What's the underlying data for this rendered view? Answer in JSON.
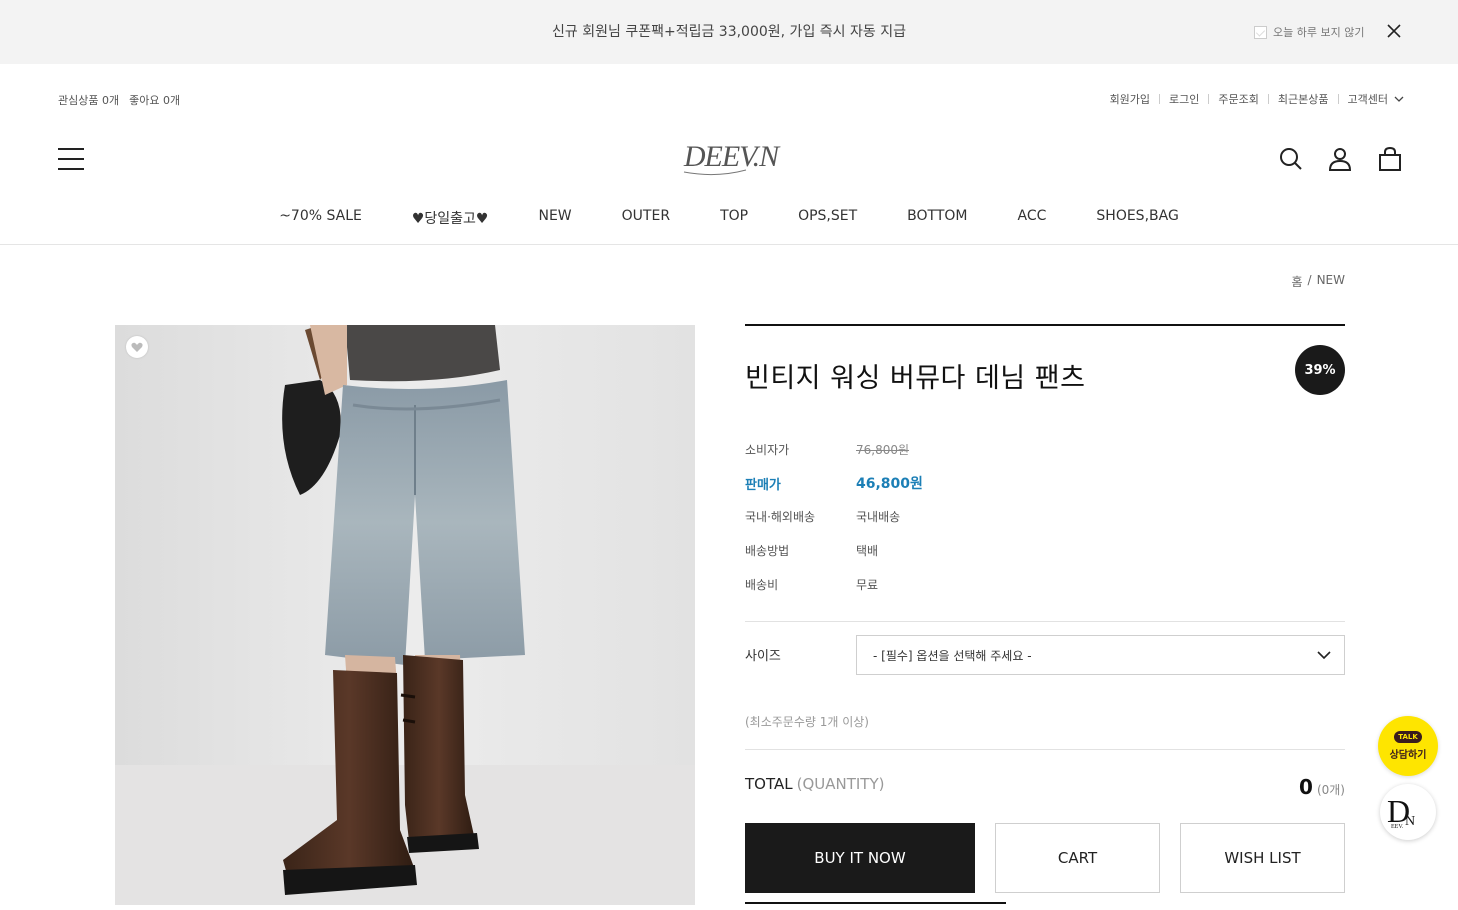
{
  "banner": {
    "text": "신규 회원님 쿠폰팩+적립금 33,000원, 가입 즉시 자동 지급",
    "dismiss_label": "오늘 하루 보지 않기"
  },
  "util": {
    "left": [
      "관심상품 0개",
      "좋아요 0개"
    ],
    "right": [
      "회원가입",
      "로그인",
      "주문조회",
      "최근본상품",
      "고객센터"
    ]
  },
  "logo": {
    "text": "DEEV.N"
  },
  "nav": [
    "~70% SALE",
    "♥당일출고♥",
    "NEW",
    "OUTER",
    "TOP",
    "OPS,SET",
    "BOTTOM",
    "ACC",
    "SHOES,BAG"
  ],
  "breadcrumb": {
    "home": "홈",
    "sep": "/",
    "current": "NEW"
  },
  "product": {
    "name": "빈티지 워싱 버뮤다 데님 팬츠",
    "discount": "39%",
    "specs": {
      "consumer_label": "소비자가",
      "consumer_value": "76,800원",
      "sale_label": "판매가",
      "sale_value": "46,800원",
      "ship_type_label": "국내·해외배송",
      "ship_type_value": "국내배송",
      "ship_method_label": "배송방법",
      "ship_method_value": "택배",
      "ship_fee_label": "배송비",
      "ship_fee_value": "무료"
    },
    "option_label": "사이즈",
    "option_select": "- [필수] 옵션을 선택해 주세요 -",
    "min_order": "(최소주문수량 1개 이상)",
    "total_label": "TOTAL",
    "total_qty_label": "(QUANTITY)",
    "total_value": "0",
    "total_count": "(0개)"
  },
  "buttons": {
    "buy": "BUY IT NOW",
    "cart": "CART",
    "wish": "WISH LIST"
  },
  "floating": {
    "talk": "TALK",
    "consult": "상담하기"
  },
  "colors": {
    "accent": "#1c7fb6",
    "dark": "#1a1a1a",
    "kakao": "#fee500"
  }
}
